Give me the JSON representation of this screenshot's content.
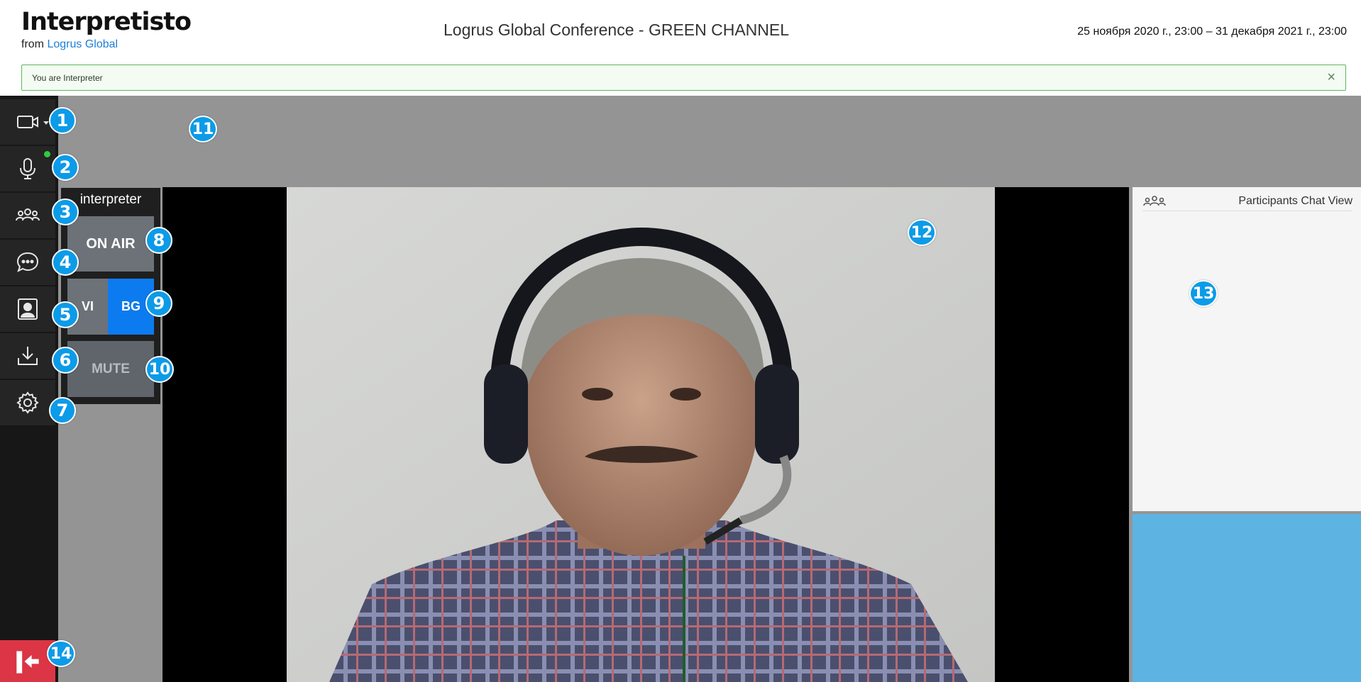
{
  "header": {
    "app_name": "Interpretisto",
    "from_text": "from",
    "from_link": "Logrus Global",
    "conference_title": "Logrus Global Conference - GREEN CHANNEL",
    "dates": "25 ноября 2020 г., 23:00 – 31 декабря 2021 г., 23:00"
  },
  "alert": {
    "text": "You are Interpreter",
    "close_icon": "×"
  },
  "sidebar": {
    "items": [
      {
        "icon": "video-camera-icon"
      },
      {
        "icon": "microphone-icon"
      },
      {
        "icon": "participants-icon"
      },
      {
        "icon": "chat-icon"
      },
      {
        "icon": "contact-card-icon"
      },
      {
        "icon": "download-icon"
      },
      {
        "icon": "settings-gear-icon"
      }
    ],
    "exit_icon": "exit-door-icon"
  },
  "interpreter_panel": {
    "label": "interpreter",
    "on_air": "ON AIR",
    "lang_from": "VI",
    "lang_to": "BG",
    "mute": "MUTE"
  },
  "chat": {
    "title": "Participants Chat View"
  },
  "markers": [
    "1",
    "2",
    "3",
    "4",
    "5",
    "6",
    "7",
    "8",
    "9",
    "10",
    "11",
    "12",
    "13",
    "14"
  ],
  "colors": {
    "sidebar": "#171717",
    "stage": "#949494",
    "active_lang": "#0d7bf0",
    "exit": "#dc3545",
    "marker": "#0c9be8",
    "alert_border": "#5cb85c",
    "blue_panel": "#5db4e3"
  }
}
